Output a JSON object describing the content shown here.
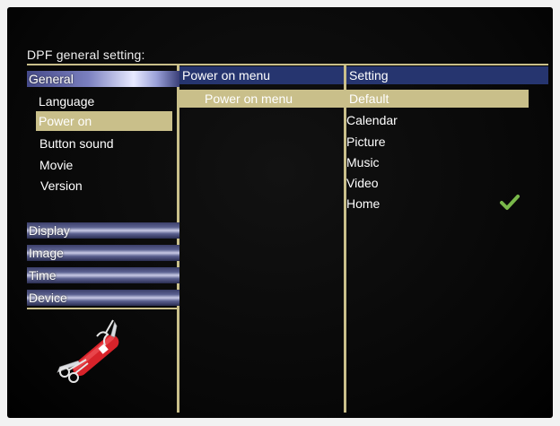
{
  "title": "DPF general setting:",
  "categories": {
    "general": "General",
    "display": "Display",
    "image": "Image",
    "time": "Time",
    "device": "Device"
  },
  "general_items": [
    "Language",
    "Power on",
    "Button sound",
    "Movie",
    "Version"
  ],
  "selected_general_item": "Power on",
  "middle": {
    "header": "Power on menu",
    "selected": "Power on menu"
  },
  "setting": {
    "header": "Setting",
    "options": [
      "Default",
      "Calendar",
      "Picture",
      "Music",
      "Video",
      "Home"
    ],
    "highlighted": "Default",
    "checked": "Home"
  },
  "colors": {
    "accent": "#c9bf8a",
    "header_blue": "#26356f",
    "check_green": "#79b84a"
  },
  "icons": [
    "check-icon",
    "multitool-icon"
  ]
}
